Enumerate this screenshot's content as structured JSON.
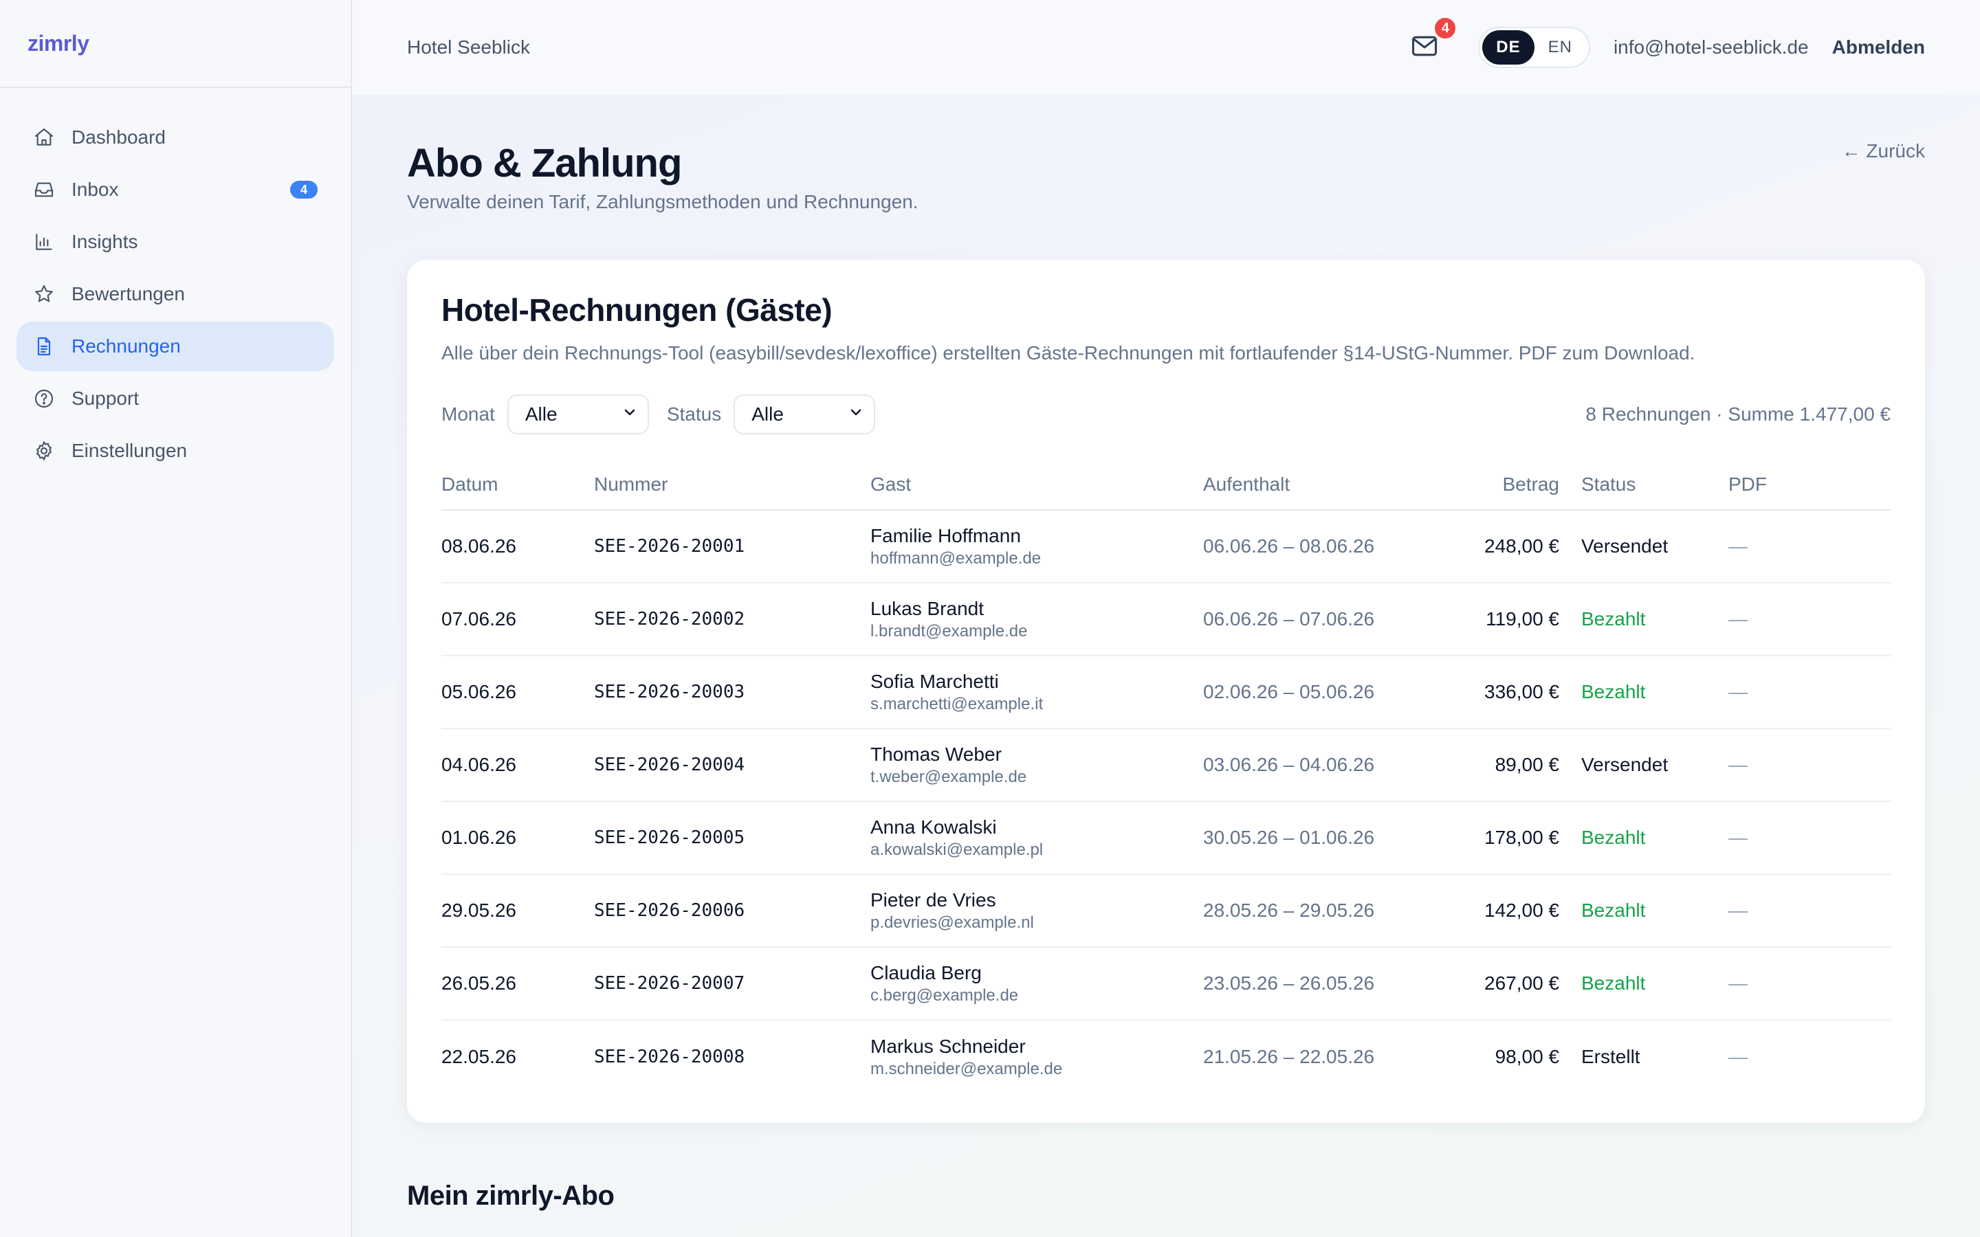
{
  "app": {
    "logo": "zimrly"
  },
  "sidebar": {
    "items": [
      {
        "label": "Dashboard",
        "icon": "home-icon"
      },
      {
        "label": "Inbox",
        "icon": "inbox-icon",
        "badge": "4"
      },
      {
        "label": "Insights",
        "icon": "bar-chart-icon"
      },
      {
        "label": "Bewertungen",
        "icon": "star-icon"
      },
      {
        "label": "Rechnungen",
        "icon": "document-icon",
        "active": true
      },
      {
        "label": "Support",
        "icon": "help-icon"
      },
      {
        "label": "Einstellungen",
        "icon": "gear-icon"
      }
    ]
  },
  "topbar": {
    "hotel": "Hotel Seeblick",
    "mail_badge": "4",
    "lang": {
      "de": "DE",
      "en": "EN",
      "active": "DE"
    },
    "email": "info@hotel-seeblick.de",
    "logout": "Abmelden"
  },
  "page": {
    "title": "Abo & Zahlung",
    "subtitle": "Verwalte deinen Tarif, Zahlungsmethoden und Rechnungen.",
    "back": "← Zurück"
  },
  "card": {
    "title": "Hotel-Rechnungen (Gäste)",
    "description": "Alle über dein Rechnungs-Tool (easybill/sevdesk/lexoffice) erstellten Gäste-Rechnungen mit fortlaufender §14-UStG-Nummer. PDF zum Download.",
    "filters": {
      "month_label": "Monat",
      "month_value": "Alle",
      "status_label": "Status",
      "status_value": "Alle"
    },
    "summary": "8 Rechnungen · Summe 1.477,00 €",
    "columns": [
      "Datum",
      "Nummer",
      "Gast",
      "Aufenthalt",
      "Betrag",
      "Status",
      "PDF"
    ],
    "rows": [
      {
        "date": "08.06.26",
        "number": "SEE-2026-20001",
        "guest": "Familie Hoffmann",
        "email": "hoffmann@example.de",
        "stay": "06.06.26 – 08.06.26",
        "amount": "248,00 €",
        "status": "Versendet",
        "pdf": "—"
      },
      {
        "date": "07.06.26",
        "number": "SEE-2026-20002",
        "guest": "Lukas Brandt",
        "email": "l.brandt@example.de",
        "stay": "06.06.26 – 07.06.26",
        "amount": "119,00 €",
        "status": "Bezahlt",
        "pdf": "—"
      },
      {
        "date": "05.06.26",
        "number": "SEE-2026-20003",
        "guest": "Sofia Marchetti",
        "email": "s.marchetti@example.it",
        "stay": "02.06.26 – 05.06.26",
        "amount": "336,00 €",
        "status": "Bezahlt",
        "pdf": "—"
      },
      {
        "date": "04.06.26",
        "number": "SEE-2026-20004",
        "guest": "Thomas Weber",
        "email": "t.weber@example.de",
        "stay": "03.06.26 – 04.06.26",
        "amount": "89,00 €",
        "status": "Versendet",
        "pdf": "—"
      },
      {
        "date": "01.06.26",
        "number": "SEE-2026-20005",
        "guest": "Anna Kowalski",
        "email": "a.kowalski@example.pl",
        "stay": "30.05.26 – 01.06.26",
        "amount": "178,00 €",
        "status": "Bezahlt",
        "pdf": "—"
      },
      {
        "date": "29.05.26",
        "number": "SEE-2026-20006",
        "guest": "Pieter de Vries",
        "email": "p.devries@example.nl",
        "stay": "28.05.26 – 29.05.26",
        "amount": "142,00 €",
        "status": "Bezahlt",
        "pdf": "—"
      },
      {
        "date": "26.05.26",
        "number": "SEE-2026-20007",
        "guest": "Claudia Berg",
        "email": "c.berg@example.de",
        "stay": "23.05.26 – 26.05.26",
        "amount": "267,00 €",
        "status": "Bezahlt",
        "pdf": "—"
      },
      {
        "date": "22.05.26",
        "number": "SEE-2026-20008",
        "guest": "Markus Schneider",
        "email": "m.schneider@example.de",
        "stay": "21.05.26 – 22.05.26",
        "amount": "98,00 €",
        "status": "Erstellt",
        "pdf": "—"
      }
    ]
  },
  "section2": {
    "title": "Mein zimrly-Abo"
  },
  "colors": {
    "accent": "#2563eb",
    "logo": "#5b5bd6",
    "paid": "#16a34a",
    "badge_red": "#ef4444",
    "badge_blue": "#3b82f6"
  }
}
